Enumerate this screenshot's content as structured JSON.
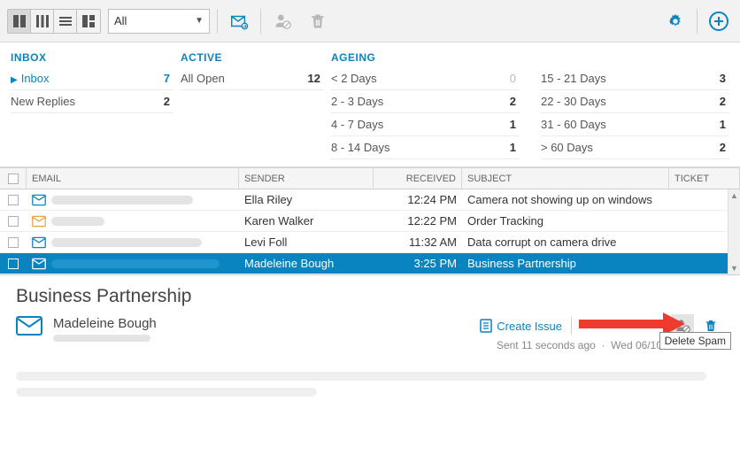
{
  "toolbar": {
    "filter_value": "All"
  },
  "summary": {
    "inbox": {
      "header": "INBOX",
      "rows": [
        {
          "label": "Inbox",
          "value": "7",
          "link": true
        },
        {
          "label": "New Replies",
          "value": "2"
        }
      ]
    },
    "active": {
      "header": "ACTIVE",
      "rows": [
        {
          "label": "All Open",
          "value": "12"
        }
      ]
    },
    "ageing": {
      "header": "AGEING",
      "left": [
        {
          "label": "< 2 Days",
          "value": "0"
        },
        {
          "label": "2 - 3 Days",
          "value": "2"
        },
        {
          "label": "4 - 7 Days",
          "value": "1"
        },
        {
          "label": "8 - 14 Days",
          "value": "1"
        }
      ],
      "right": [
        {
          "label": "15 - 21 Days",
          "value": "3"
        },
        {
          "label": "22 - 30 Days",
          "value": "2"
        },
        {
          "label": "31 - 60 Days",
          "value": "1"
        },
        {
          "label": "> 60 Days",
          "value": "2"
        }
      ]
    }
  },
  "grid": {
    "headers": {
      "email": "EMAIL",
      "sender": "SENDER",
      "received": "RECEIVED",
      "subject": "SUBJECT",
      "ticket": "TICKET"
    },
    "rows": [
      {
        "sender": "Ella Riley",
        "received": "12:24 PM",
        "subject": "Camera not showing up on windows",
        "icon_color": "#0a84c1",
        "redact_w": 160
      },
      {
        "sender": "Karen Walker",
        "received": "12:22 PM",
        "subject": "Order Tracking",
        "icon_color": "#e8a33d",
        "redact_w": 60
      },
      {
        "sender": "Levi Foll",
        "received": "11:32 AM",
        "subject": "Data corrupt on camera drive",
        "icon_color": "#0a84c1",
        "redact_w": 170
      },
      {
        "sender": "Madeleine Bough",
        "received": "3:25 PM",
        "subject": "Business Partnership",
        "icon_color": "#ffffff",
        "redact_w": 190,
        "selected": true
      }
    ]
  },
  "detail": {
    "title": "Business Partnership",
    "from_name": "Madeleine Bough",
    "create_issue_label": "Create Issue",
    "sent_ago": "Sent 11 seconds ago",
    "sent_date": "Wed 06/10/2",
    "tooltip": "Delete Spam"
  }
}
